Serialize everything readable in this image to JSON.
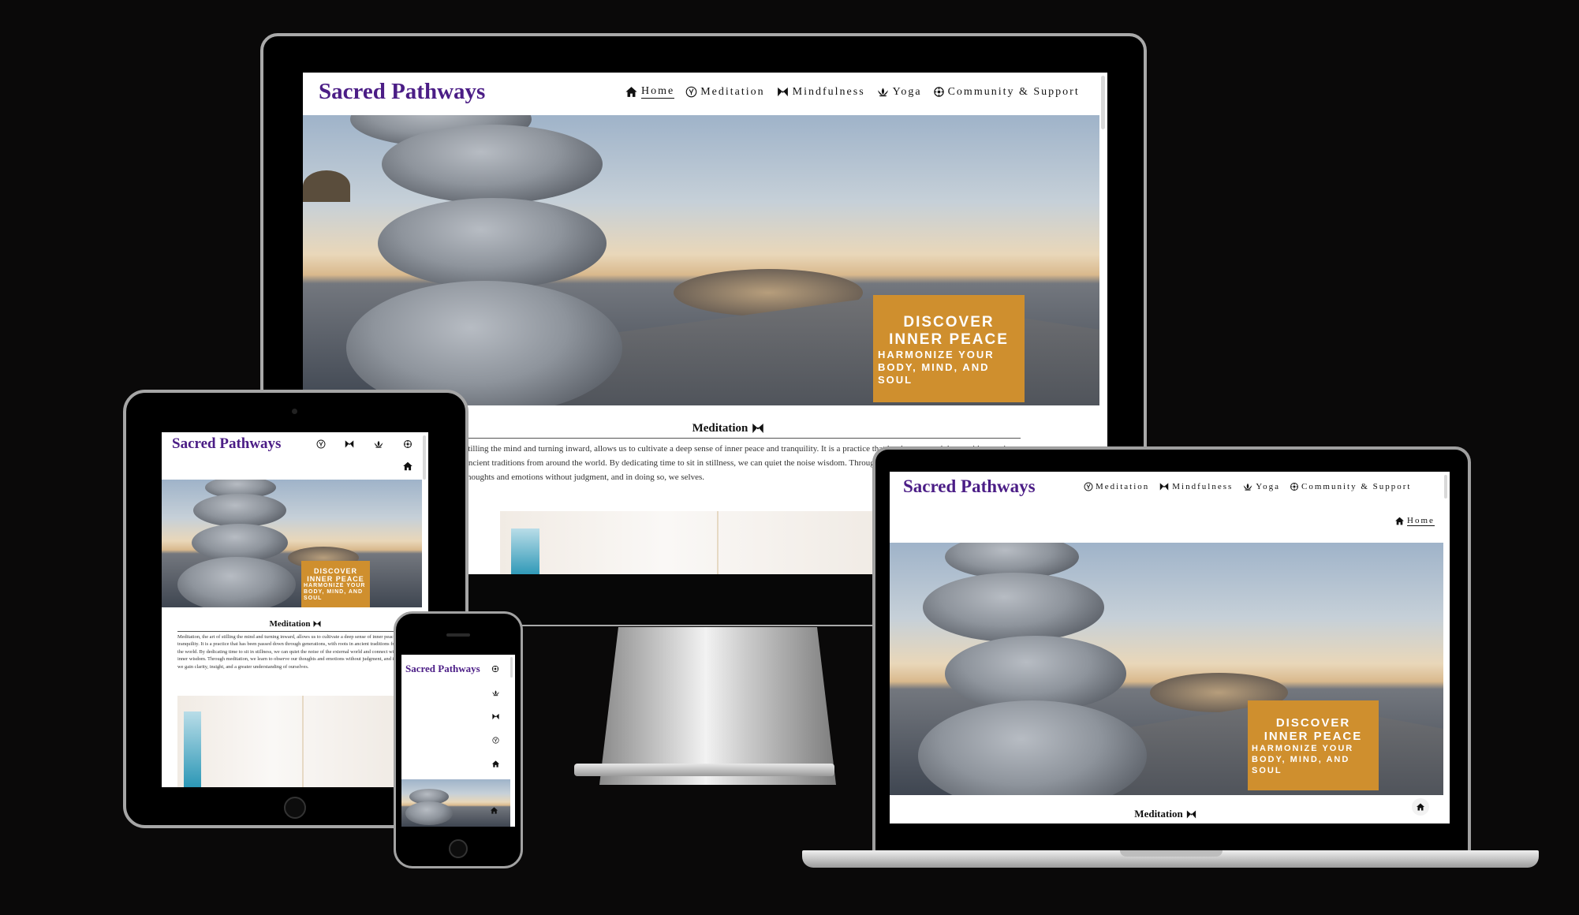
{
  "site": {
    "brand": "Sacred Pathways",
    "nav": [
      {
        "label": "Home",
        "icon": "home-icon"
      },
      {
        "label": "Meditation",
        "icon": "meditation-icon"
      },
      {
        "label": "Mindfulness",
        "icon": "mindfulness-icon"
      },
      {
        "label": "Yoga",
        "icon": "lotus-icon"
      },
      {
        "label": "Community & Support",
        "icon": "community-icon"
      }
    ],
    "hero": {
      "heading_line1": "DISCOVER",
      "heading_line2": "INNER PEACE",
      "subheading": "HARMONIZE YOUR BODY, MIND, AND SOUL"
    },
    "section_title": "Meditation",
    "intro_desktop": "stilling the mind and turning inward, allows us to cultivate a deep sense of inner peace and tranquility. It is a practice that has been passed down with roots in ancient traditions from around the world. By dedicating time to sit in stillness, we can quiet the noise wisdom. Through meditation, we learn to observe our thoughts and emotions without judgment, and in doing so, we selves.",
    "intro_tablet": "Meditation, the art of stilling the mind and turning inward, allows us to cultivate a deep sense of inner peace and tranquility. It is a practice that has been passed down through generations, with roots in ancient traditions from around the world. By dedicating time to sit in stillness, we can quiet the noise of the external world and connect with our own inner wisdom. Through meditation, we learn to observe our thoughts and emotions without judgment, and in doing so, we gain clarity, insight, and a greater understanding of ourselves."
  },
  "colors": {
    "background": "#0a0909",
    "brand": "#4b1d86",
    "cta": "#cf8f2e"
  }
}
